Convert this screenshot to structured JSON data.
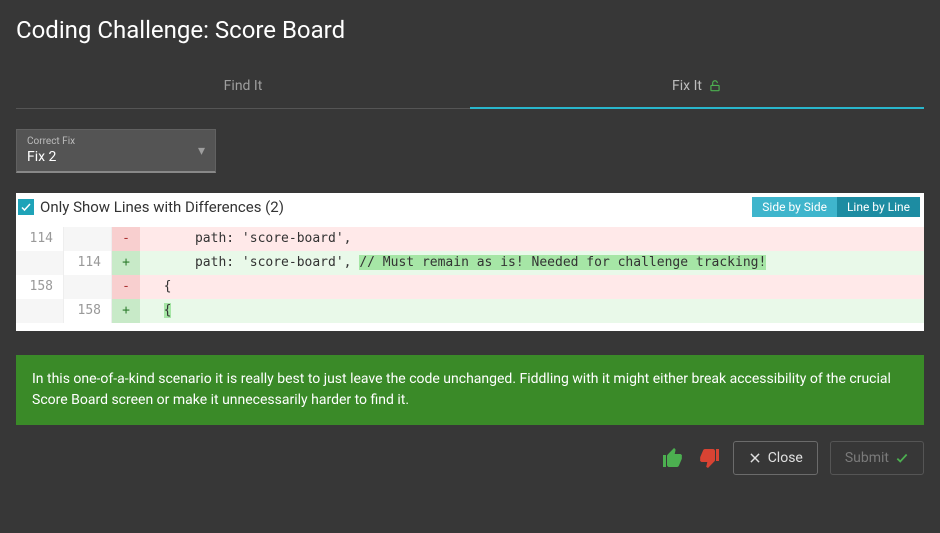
{
  "title": "Coding Challenge: Score Board",
  "tabs": {
    "find": "Find It",
    "fix": "Fix It"
  },
  "dropdown": {
    "label": "Correct Fix",
    "value": "Fix 2"
  },
  "diff": {
    "toggleLabel": "Only Show Lines with Differences (2)",
    "view": {
      "side": "Side by Side",
      "line": "Line by Line"
    },
    "rows": [
      {
        "oldLine": "114",
        "newLine": "",
        "sign": "-",
        "kind": "del",
        "pre": "      path: 'score-board',",
        "hl": ""
      },
      {
        "oldLine": "",
        "newLine": "114",
        "sign": "+",
        "kind": "add",
        "pre": "      path: 'score-board', ",
        "hl": "// Must remain as is! Needed for challenge tracking!"
      },
      {
        "oldLine": "158",
        "newLine": "",
        "sign": "-",
        "kind": "del",
        "pre": "  {",
        "hl": ""
      },
      {
        "oldLine": "",
        "newLine": "158",
        "sign": "+",
        "kind": "add",
        "pre": "  ",
        "hl": "{"
      }
    ]
  },
  "info": "In this one-of-a-kind scenario it is really best to just leave the code unchanged. Fiddling with it might either break accessibility of the crucial Score Board screen or make it unnecessarily harder to find it.",
  "actions": {
    "close": "Close",
    "submit": "Submit"
  },
  "colors": {
    "accent": "#1fa3b8",
    "success": "#3a8a28",
    "thumbUp": "#4caf50",
    "thumbDown": "#d84333",
    "submitCheck": "#4caf50"
  }
}
